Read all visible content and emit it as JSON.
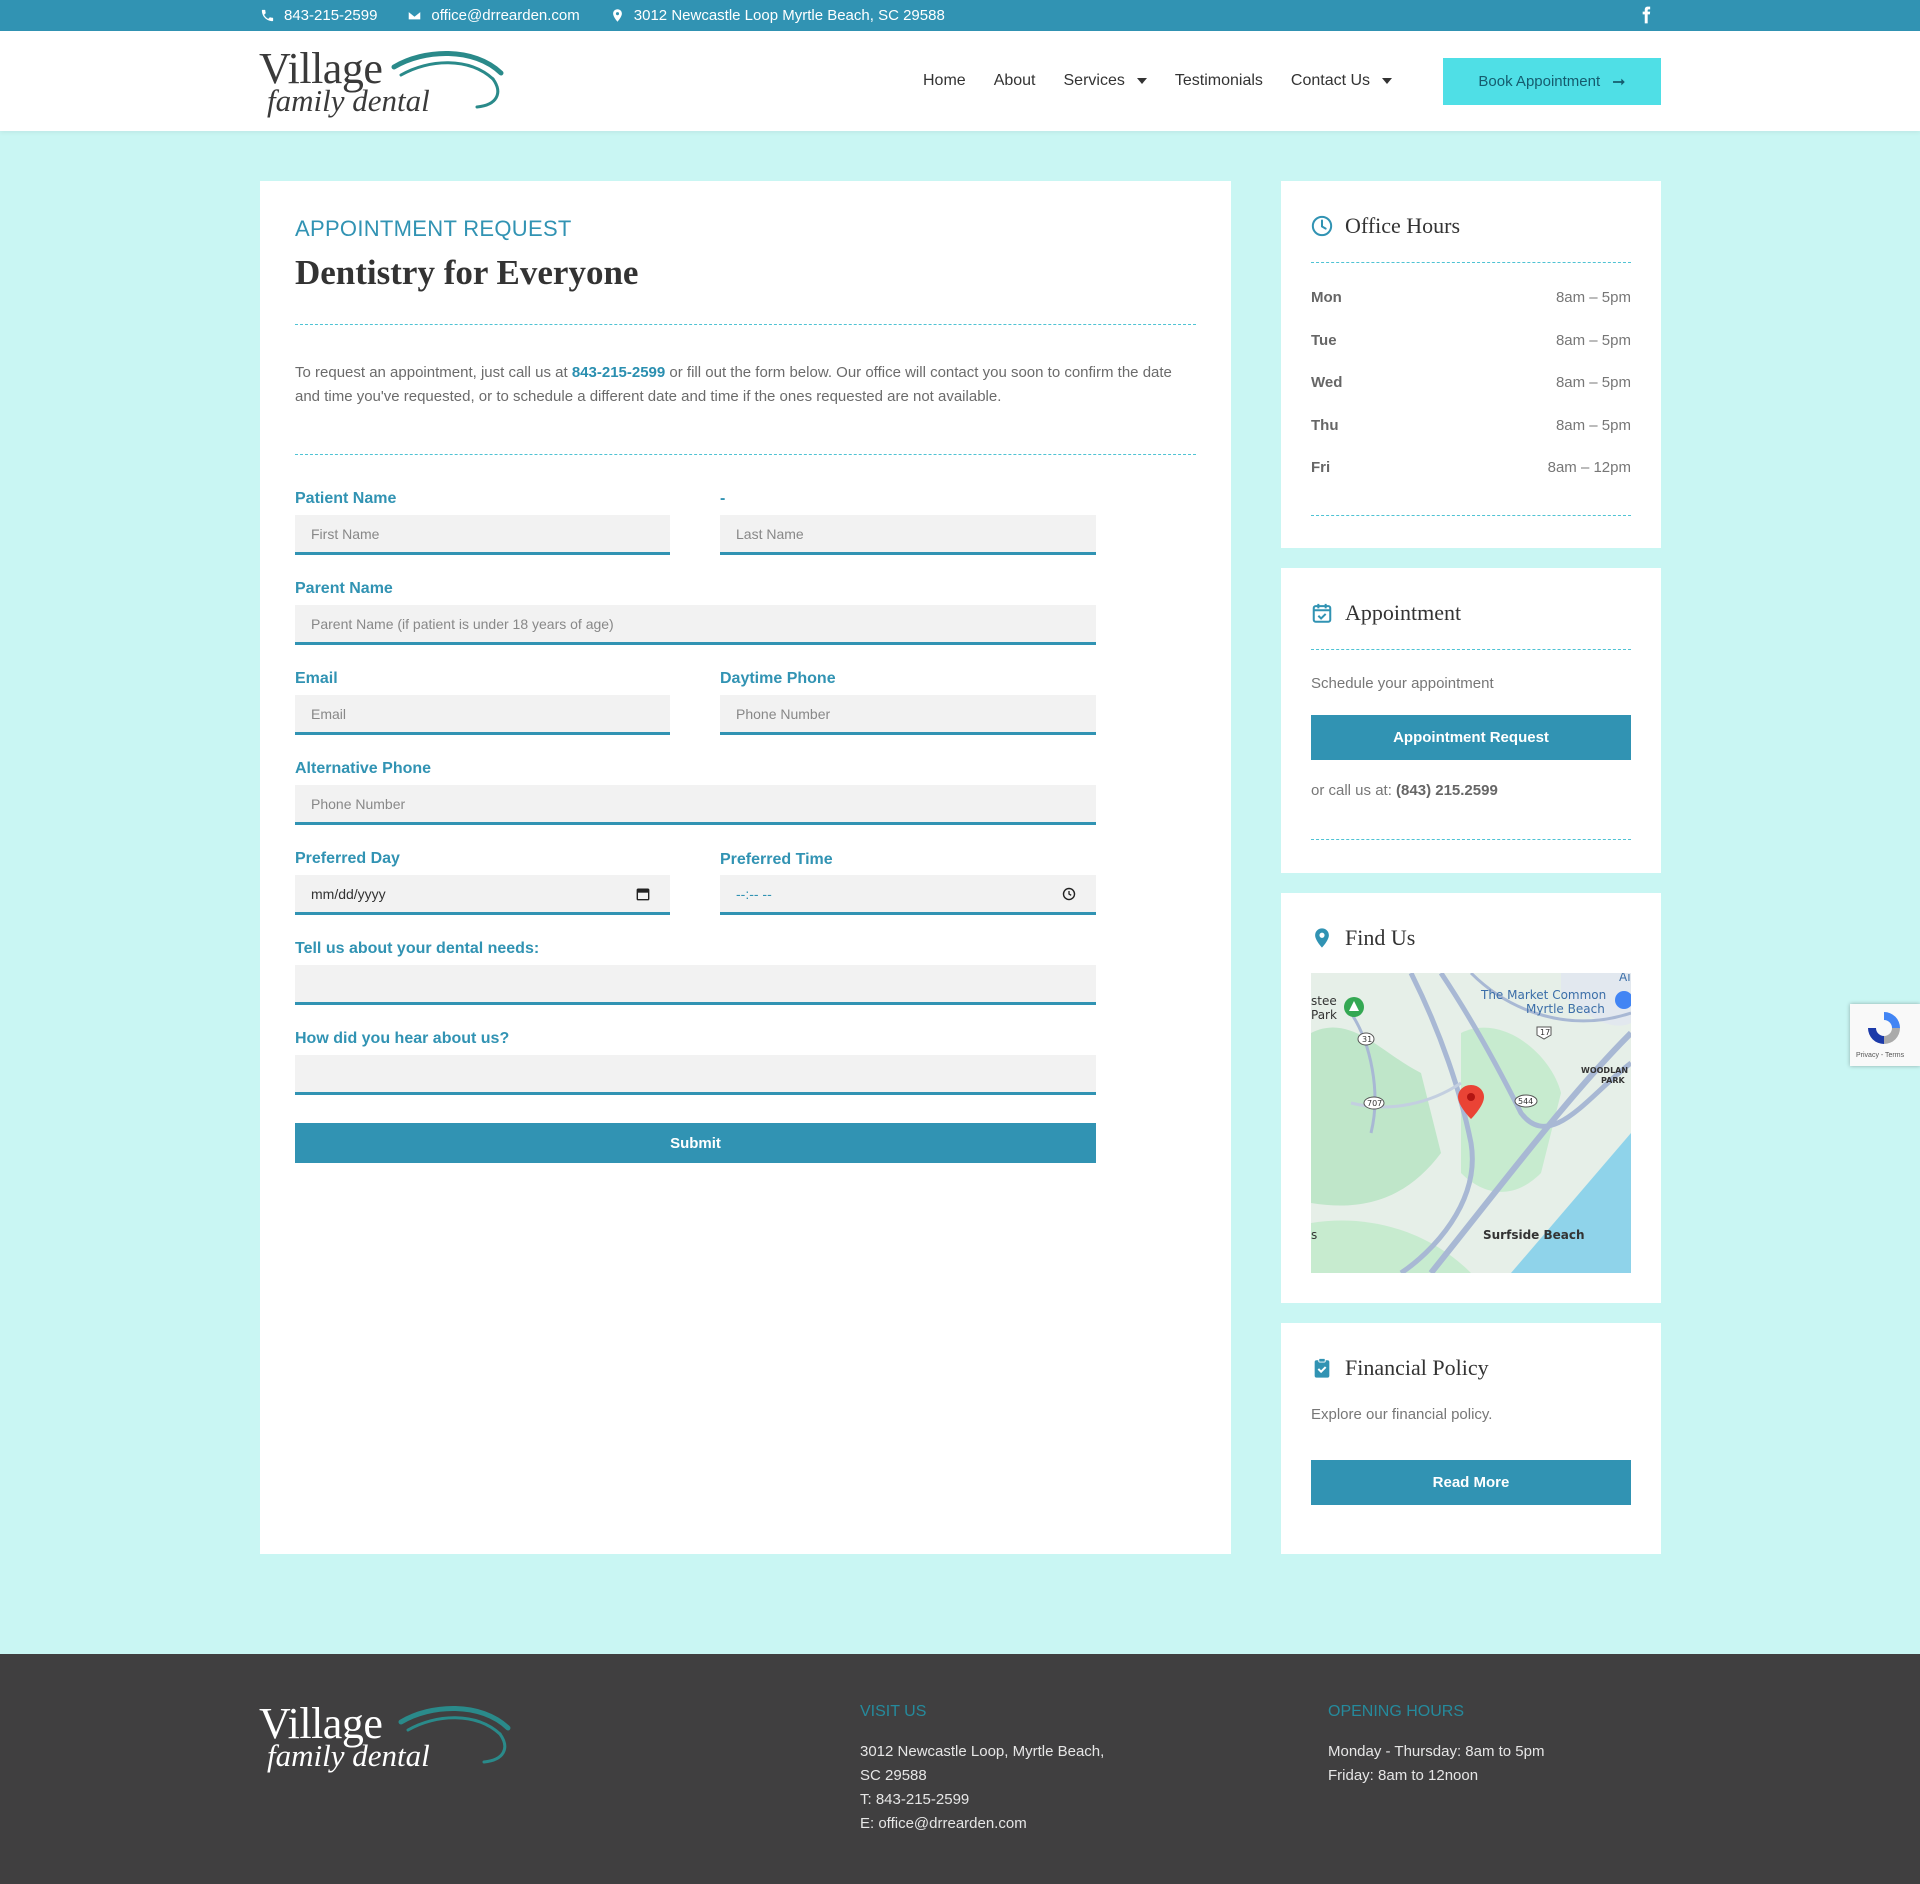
{
  "topbar": {
    "phone": "843-215-2599",
    "email": "office@drrearden.com",
    "address": "3012 Newcastle Loop Myrtle Beach, SC 29588"
  },
  "brand": {
    "line1": "Village",
    "line2": "family dental",
    "accent": "#2a8a8a"
  },
  "nav": {
    "home": "Home",
    "about": "About",
    "services": "Services",
    "testimonials": "Testimonials",
    "contact": "Contact Us",
    "book": "Book Appointment"
  },
  "main": {
    "kicker": "APPOINTMENT REQUEST",
    "title": "Dentistry for Everyone",
    "intro_before": "To request an appointment, just call us at ",
    "intro_phone": "843-215-2599",
    "intro_after": " or fill out the form below.  Our office will contact you soon to confirm the date and time you've requested, or to schedule a different date and time if the ones requested are not available."
  },
  "form": {
    "patient_label": "Patient Name",
    "last_label": "-",
    "first_placeholder": "First Name",
    "last_placeholder": "Last Name",
    "parent_label": "Parent Name",
    "parent_placeholder": "Parent Name (if patient is under 18 years of age)",
    "email_label": "Email",
    "email_placeholder": "Email",
    "day_phone_label": "Daytime Phone",
    "day_phone_placeholder": "Phone Number",
    "alt_phone_label": "Alternative Phone",
    "alt_phone_placeholder": "Phone Number",
    "pref_day_label": "Preferred Day",
    "pref_day_value": "mm/dd/yyyy",
    "pref_time_label": "Preferred Time",
    "pref_time_value": "--:-- --",
    "needs_label": "Tell us about your dental needs:",
    "hear_label": "How did you hear about us?",
    "submit": "Submit"
  },
  "hours": {
    "title": "Office Hours",
    "rows": [
      {
        "day": "Mon",
        "time": "8am – 5pm"
      },
      {
        "day": "Tue",
        "time": "8am – 5pm"
      },
      {
        "day": "Wed",
        "time": "8am – 5pm"
      },
      {
        "day": "Thu",
        "time": "8am – 5pm"
      },
      {
        "day": "Fri",
        "time": "8am – 12pm"
      }
    ]
  },
  "appointment": {
    "title": "Appointment",
    "text": "Schedule your appointment",
    "button": "Appointment Request",
    "call_prefix": "or call us at: ",
    "call_phone": "(843) 215.2599"
  },
  "findus": {
    "title": "Find Us",
    "map_labels": {
      "market": "The Market Common",
      "market2": "Myrtle Beach",
      "woodland": "WOODLAN",
      "park": "PARK",
      "surfside": "Surfside Beach",
      "statepark1": "stee",
      "statepark2": "Park",
      "route31": "31",
      "route707": "707",
      "route17": "17",
      "route544": "544",
      "airport": "Airp",
      "edge_s": "s"
    }
  },
  "financial": {
    "title": "Financial Policy",
    "text": "Explore our financial policy.",
    "button": "Read More"
  },
  "recaptcha": {
    "text": "Privacy - Terms"
  },
  "footer": {
    "visit_title": "VISIT US",
    "visit_lines": [
      "3012 Newcastle Loop, Myrtle Beach,",
      "SC 29588",
      "T: 843-215-2599",
      "E: office@drrearden.com"
    ],
    "hours_title": "OPENING HOURS",
    "hours_lines": [
      "Monday - Thursday: 8am to 5pm",
      "Friday: 8am to 12noon"
    ]
  },
  "colors": {
    "primary": "#3193b3",
    "book_button": "#4fdfe6",
    "page_bg": "#c9f6f3",
    "footer_bg": "#403f40"
  },
  "icons": [
    "phone-icon",
    "envelope-icon",
    "map-pin-icon",
    "facebook-icon",
    "clock-icon",
    "calendar-check-icon",
    "location-pin-icon",
    "clipboard-check-icon",
    "arrow-right-icon"
  ]
}
